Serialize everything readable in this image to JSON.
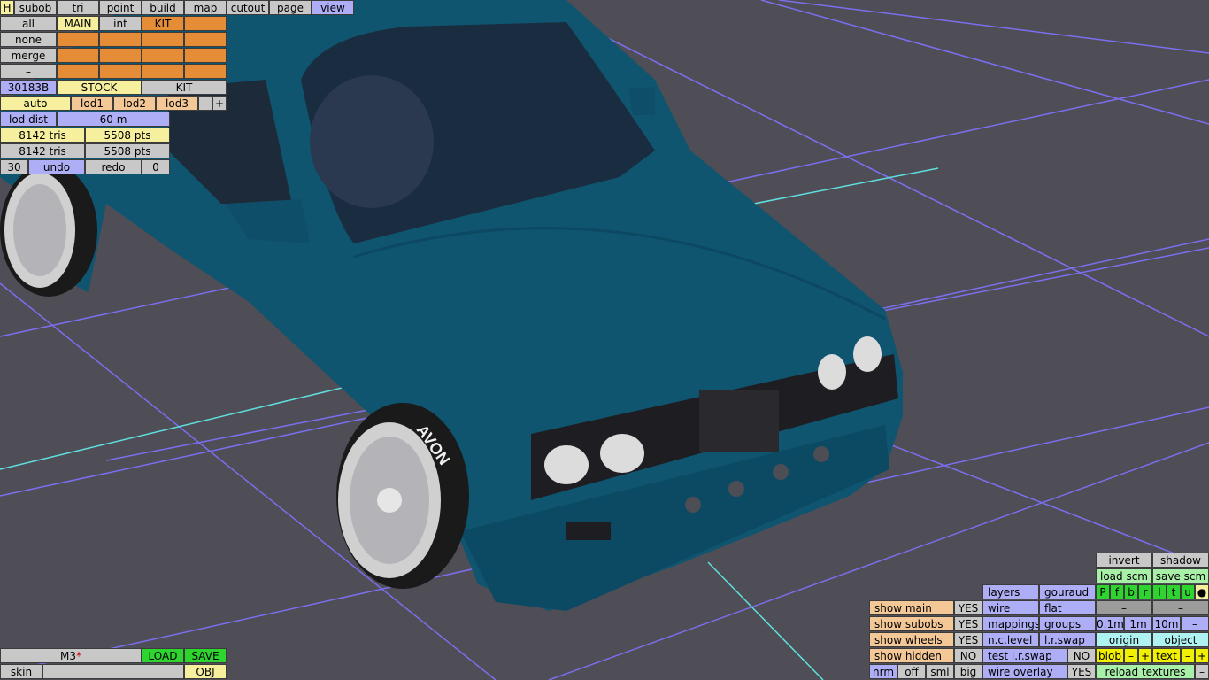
{
  "top_tabs": [
    "H",
    "subob",
    "tri",
    "point",
    "build",
    "map",
    "cutout",
    "page",
    "view"
  ],
  "row_all": [
    "all",
    "MAIN",
    "int",
    "KIT"
  ],
  "row_none": "none",
  "row_merge": "merge",
  "row_dash": "–",
  "row_version": [
    "30183B",
    "STOCK",
    "KIT"
  ],
  "row_lod": [
    "auto",
    "lod1",
    "lod2",
    "lod3",
    "–",
    "+"
  ],
  "lod_dist": {
    "label": "lod dist",
    "value": "60 m"
  },
  "stats": [
    {
      "tris": "8142 tris",
      "pts": "5508 pts"
    },
    {
      "tris": "8142 tris",
      "pts": "5508 pts"
    }
  ],
  "undo_row": {
    "count": "30",
    "undo": "undo",
    "redo": "redo",
    "redo_count": "0"
  },
  "bottom_left": {
    "name": "M3",
    "star": "*",
    "load": "LOAD",
    "save": "SAVE",
    "skin": "skin",
    "obj": "OBJ"
  },
  "right_panel": {
    "invert": "invert",
    "shadow": "shadow",
    "load_scm": "load scm",
    "save_scm": "save scm",
    "flags": [
      "P",
      "f",
      "b",
      "r",
      "l",
      "t",
      "u",
      "●"
    ],
    "layers": "layers",
    "gouraud": "gouraud",
    "wire": "wire",
    "flat": "flat",
    "dash1": "–",
    "dash2": "–",
    "mappings": "mappings",
    "groups": "groups",
    "d01": "0.1m",
    "d1": "1m",
    "d10": "10m",
    "dminus": "–",
    "nclevel": "n.c.level",
    "lrswap": "l.r.swap",
    "origin": "origin",
    "object": "object",
    "test_lrswap": "test l.r.swap",
    "test_lrswap_val": "NO",
    "blob": "blob",
    "blob_minus": "–",
    "blob_plus": "+",
    "text": "text",
    "text_minus": "–",
    "text_plus": "+",
    "wire_overlay": "wire overlay",
    "wire_overlay_val": "YES",
    "reload_textures": "reload textures",
    "show_main": "show main",
    "show_main_val": "YES",
    "show_subobs": "show subobs",
    "show_subobs_val": "YES",
    "show_wheels": "show wheels",
    "show_wheels_val": "YES",
    "show_hidden": "show hidden",
    "show_hidden_val": "NO",
    "nrm": "nrm",
    "off": "off",
    "sml": "sml",
    "big": "big"
  },
  "tire_brand": "AVON",
  "colors": {
    "car": "#0f5570",
    "grid": "#7a6ff0",
    "axis": "#5fe0e0",
    "background": "#4f4e56"
  }
}
